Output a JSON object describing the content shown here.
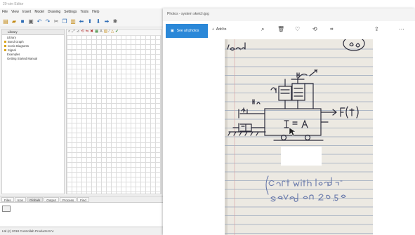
{
  "editor": {
    "title": "20-sim Editor",
    "menu": [
      "File",
      "View",
      "Insert",
      "Model",
      "Drawing",
      "Settings",
      "Tools",
      "Help"
    ],
    "toolbar_icons": [
      "new-file-icon",
      "open-folder-icon",
      "save-icon",
      "print-icon",
      "undo-icon",
      "redo-icon",
      "cut-icon",
      "copy-icon",
      "paste-icon",
      "go-up-icon",
      "go-down-icon",
      "go-forward-icon",
      "settings-icon"
    ],
    "library_tab": "Library",
    "tree": [
      {
        "label": "Library",
        "bullet": false
      },
      {
        "label": "Bond Graph",
        "bullet": true
      },
      {
        "label": "Iconic Diagrams",
        "bullet": true
      },
      {
        "label": "Signal",
        "bullet": true
      },
      {
        "label": "Examples",
        "bullet": false
      },
      {
        "label": "Getting Started Manual",
        "bullet": false
      }
    ],
    "bottom_tabs": [
      "Files",
      "Icon",
      "Globals",
      "Output",
      "Process",
      "Find"
    ],
    "status": "Ltd (c) 2018 Controllab Products B.V."
  },
  "photos": {
    "title": "Photos - system sketch.jpg",
    "see_all_label": "See all photos",
    "add_to_label": "Add to",
    "toolbar_icons": [
      "zoom-icon",
      "delete-icon",
      "heart-icon",
      "rotate-icon",
      "crop-icon",
      "share-icon",
      "more-icon"
    ],
    "photo": {
      "subject": "handwritten notes on lined paper",
      "visible_text": [
        "load",
        "I = A",
        "F(t)",
        "Cart with load",
        "saved on 20.5"
      ],
      "paper_color": "#ece9e2",
      "line_color": "#9aa7bd"
    }
  }
}
